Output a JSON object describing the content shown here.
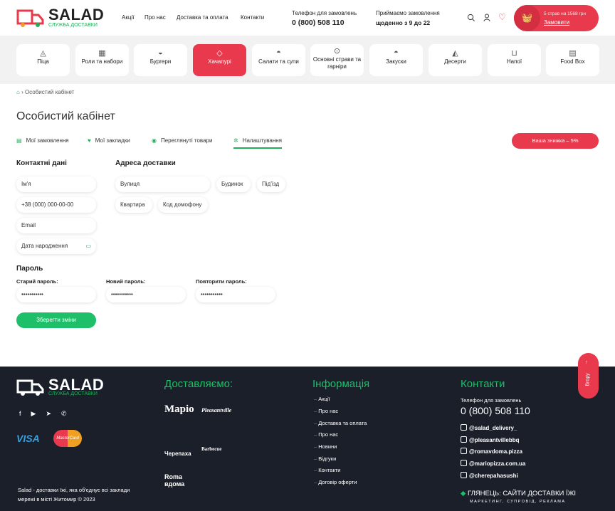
{
  "header": {
    "logo": "SALAD",
    "logo_sub": "СЛУЖБА ДОСТАВКИ",
    "nav": [
      "Акції",
      "Про нас",
      "Доставка та оплата",
      "Контакти"
    ],
    "phone_label": "Телефон для замовлень",
    "phone": "0 (800) 508 110",
    "hours_label": "Приймаємо замовлення",
    "hours": "щоденно з 9 до 22",
    "cart_summary": "5 страв на 1568 грн",
    "cart_order": "Замовити",
    "accent": "#e8394d",
    "green": "#1fae5a"
  },
  "categories": [
    {
      "label": "Піца",
      "icon": "pizza-icon"
    },
    {
      "label": "Роли та набори",
      "icon": "rolls-icon"
    },
    {
      "label": "Бургери",
      "icon": "burger-icon"
    },
    {
      "label": "Хачапурі",
      "icon": "khachapuri-icon",
      "active": true
    },
    {
      "label": "Салати та супи",
      "icon": "salad-icon"
    },
    {
      "label": "Основні страви та гарніри",
      "icon": "plate-icon"
    },
    {
      "label": "Закуски",
      "icon": "snack-icon"
    },
    {
      "label": "Десерти",
      "icon": "cake-icon"
    },
    {
      "label": "Напої",
      "icon": "drink-icon"
    },
    {
      "label": "Food Box",
      "icon": "foodbox-icon"
    }
  ],
  "breadcrumb": {
    "current": "Особистий кабінет"
  },
  "page": {
    "title": "Особистий кабінет",
    "tabs": [
      "Мої замовлення",
      "Мої закладки",
      "Переглянуті товари",
      "Налаштування"
    ],
    "active_tab": "Налаштування",
    "discount": "Ваша знижка – 5%"
  },
  "contact": {
    "title": "Контактні дані",
    "name": "Ім'я",
    "phone": "+38 (000) 000-00-00",
    "email": "Email",
    "birth": "Дата народження"
  },
  "address": {
    "title": "Адреса доставки",
    "street": "Вулиця",
    "house": "Будинок",
    "entrance": "Під'їзд",
    "flat": "Квартира",
    "code": "Код домофону"
  },
  "password": {
    "title": "Пароль",
    "old": "Старий пароль:",
    "new": "Новий пароль:",
    "repeat": "Повторити пароль:",
    "mask": "•••••••••••"
  },
  "save": "Зберегти зміни",
  "to_top": "Вгору",
  "footer": {
    "logo": "SALAD",
    "logo_sub": "СЛУЖБА ДОСТАВКИ",
    "deliver_title": "Доставляємо:",
    "partners": [
      "Маріо",
      "Pleasantville",
      "Черепаха",
      "Barbecue",
      "Roma вдома"
    ],
    "info_title": "Інформація",
    "info_links": [
      "Акції",
      "Про нас",
      "Доставка та оплата",
      "Про нас",
      "Новини",
      "Відгуки",
      "Контакти",
      "Договір оферти"
    ],
    "contacts_title": "Контакти",
    "phone_label": "Телефон для замовлень",
    "phone": "0 (800) 508 110",
    "instagram": [
      "@salad_delivery_",
      "@pleasantvillebbq",
      "@romavdoma.pizza",
      "@mariopizza.com.ua",
      "@cherepahasushi"
    ],
    "about": "Salad - доставки їжі, яка об'єднує всі заклади мережі в місті Житомир © 2023",
    "dev": "ГЛЯНЕЦЬ: САЙТИ ДОСТАВКИ ЇЖІ",
    "dev_sub": "МАРКЕТИНГ, СУПРОВІД, РЕКЛАМА",
    "payments": [
      "VISA",
      "MasterCard"
    ]
  }
}
